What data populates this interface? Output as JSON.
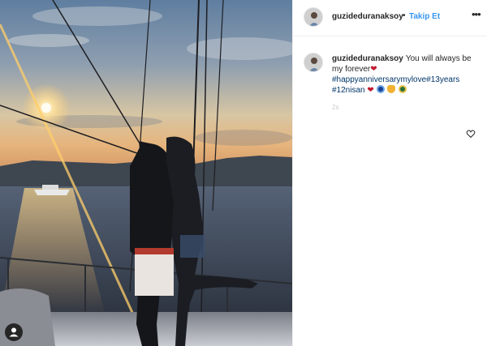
{
  "post": {
    "username": "guzideduranaksoy",
    "separator": "•",
    "follow_label": "Takip Et",
    "more_label": "•••"
  },
  "caption": {
    "username": "guzideduranaksoy",
    "text": "You will always be my forever",
    "heart": "❤",
    "hashtag_1": "#happyanniversarymylove",
    "hashtag_2": "#13years",
    "hashtag_3": "#12nisan",
    "time": "2s"
  },
  "colors": {
    "follow_blue": "#3897f0",
    "hashtag_blue": "#003569",
    "heart_red": "#c0192e"
  },
  "icons": {
    "header_menu": "more-icon",
    "like": "heart-outline-icon",
    "photo_tags": "person-tag-icon"
  }
}
